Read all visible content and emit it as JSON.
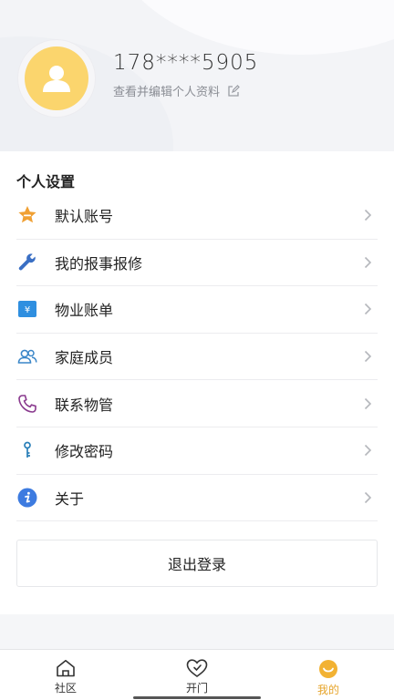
{
  "profile": {
    "phone": "178****5905",
    "edit_label": "查看并编辑个人资料",
    "avatar_color": "#fbd56d"
  },
  "settings": {
    "title": "个人设置",
    "items": [
      {
        "label": "默认账号",
        "icon": "star-badge-icon"
      },
      {
        "label": "我的报事报修",
        "icon": "wrench-icon"
      },
      {
        "label": "物业账单",
        "icon": "bill-icon"
      },
      {
        "label": "家庭成员",
        "icon": "people-icon"
      },
      {
        "label": "联系物管",
        "icon": "phone-icon"
      },
      {
        "label": "修改密码",
        "icon": "key-icon"
      },
      {
        "label": "关于",
        "icon": "info-icon"
      }
    ],
    "logout_label": "退出登录"
  },
  "tabbar": {
    "tabs": [
      {
        "label": "社区",
        "icon": "home-icon"
      },
      {
        "label": "开门",
        "icon": "heart-key-icon"
      },
      {
        "label": "我的",
        "icon": "smile-icon",
        "active": true
      }
    ],
    "accent": "#e6a42a"
  }
}
